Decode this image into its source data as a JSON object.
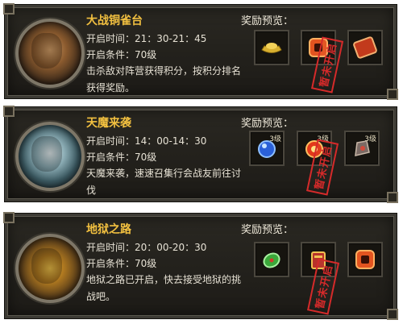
{
  "events": [
    {
      "title": "大战铜雀台",
      "open_time": "开启时间：21：30-21：45",
      "condition": "开启条件：70级",
      "description": "击杀敌对阵营获得积分，按积分排名获得奖励。",
      "reward_title": "奖励预览：",
      "rewards": [
        {
          "icon": "gold-ingot-icon",
          "level": ""
        },
        {
          "icon": "red-gem-icon",
          "level": ""
        },
        {
          "icon": "red-token-icon",
          "level": ""
        }
      ],
      "stamp": "暂未开启"
    },
    {
      "title": "天魔来袭",
      "open_time": "开启时间：14：00-14：30",
      "condition": "开启条件：70级",
      "description": "天魔来袭，速速召集行会战友前往讨伐",
      "reward_title": "奖励预览：",
      "rewards": [
        {
          "icon": "blue-orb-icon",
          "level": "3级"
        },
        {
          "icon": "fire-orb-icon",
          "level": "3级"
        },
        {
          "icon": "stone-fist-icon",
          "level": "3级"
        }
      ],
      "stamp": "暂未开启"
    },
    {
      "title": "地狱之路",
      "open_time": "开启时间：20：00-20：30",
      "condition": "开启条件：70级",
      "description": "地狱之路已开启，快去接受地狱的挑战吧。",
      "reward_title": "奖励预览：",
      "rewards": [
        {
          "icon": "green-jade-icon",
          "level": ""
        },
        {
          "icon": "treasure-scroll-icon",
          "level": ""
        },
        {
          "icon": "red-gem-icon",
          "level": ""
        }
      ],
      "stamp": "暂未开启"
    }
  ]
}
